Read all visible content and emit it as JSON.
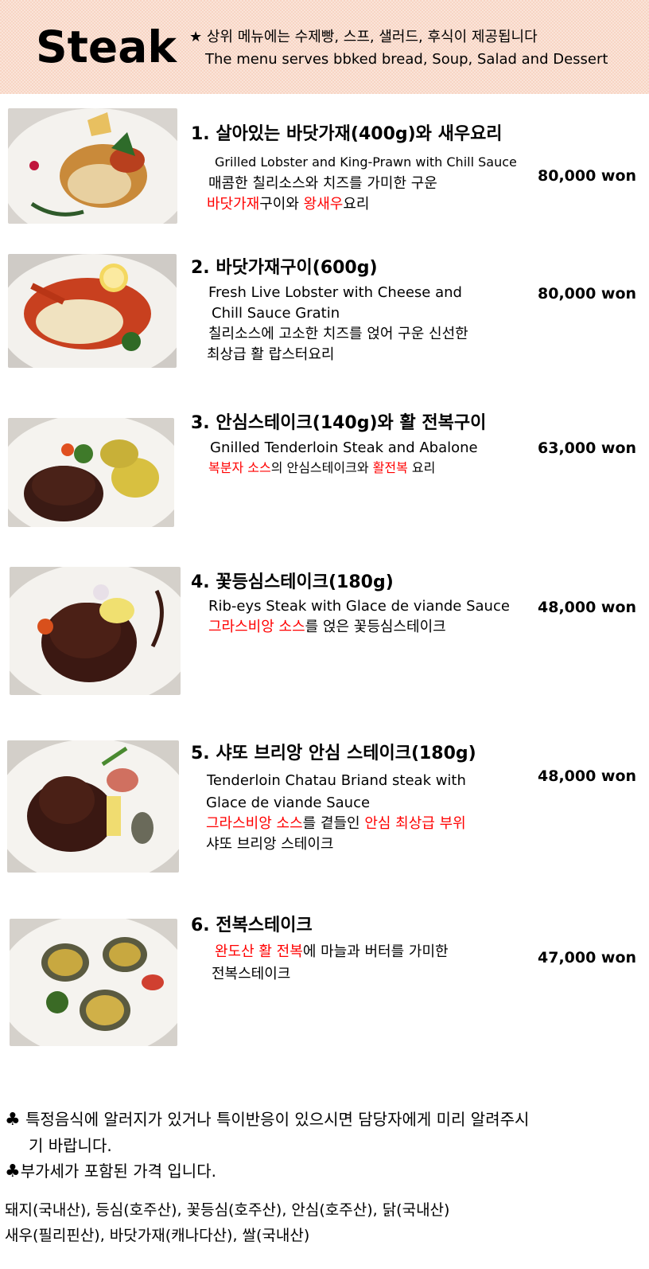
{
  "header": {
    "title": "Steak",
    "note_ko": "★ 상위 메뉴에는 수제빵, 스프, 샐러드, 후식이 제공됩니다",
    "note_en": "The menu serves bbked bread, Soup, Salad and Dessert"
  },
  "items": [
    {
      "name": "1. 살아있는 바닷가재(400g)와 새우요리",
      "en": "Grilled Lobster and King-Prawn with Chill Sauce",
      "ko_1": "매콤한 칠리소스와 치즈를 가미한 구운",
      "ko_2_red_a": "바닷가재",
      "ko_2_mid": "구이와 ",
      "ko_2_red_b": "왕새우",
      "ko_2_end": "요리",
      "price": "80,000 won"
    },
    {
      "name": "2. 바닷가재구이(600g)",
      "en_1": "Fresh Live Lobster with Cheese and",
      "en_2": "Chill Sauce Gratin",
      "ko_1": "칠리소스에 고소한 치즈를 얹어 구운 신선한",
      "ko_2": "최상급 활 랍스터요리",
      "price": "80,000 won"
    },
    {
      "name": "3. 안심스테이크(140g)와 활 전복구이",
      "en": "Gnilled Tenderloin Steak and Abalone",
      "ko_red_a": "복분자 소스",
      "ko_mid": "의 안심스테이크와 ",
      "ko_red_b": "활전복",
      "ko_end": " 요리",
      "price": "63,000 won"
    },
    {
      "name": "4. 꽃등심스테이크(180g)",
      "en": "Rib-eys Steak with Glace de viande Sauce",
      "ko_red": "그라스비앙 소스",
      "ko_end": "를 얹은 꽃등심스테이크",
      "price": "48,000 won"
    },
    {
      "name": "5. 샤또 브리앙 안심 스테이크(180g)",
      "en_1": "Tenderloin Chatau Briand steak with",
      "en_2": "Glace de viande Sauce",
      "ko_red_a": "그라스비앙 소스",
      "ko_mid": "를 곁들인 ",
      "ko_red_b": "안심 최상급 부위",
      "ko_2": "샤또 브리앙 스테이크",
      "price": "48,000 won"
    },
    {
      "name": "6. 전복스테이크",
      "ko_red": "완도산 활 전복",
      "ko_end": "에 마늘과 버터를 가미한",
      "ko_2": "전복스테이크",
      "price": "47,000 won"
    }
  ],
  "notes": {
    "club_icon": "♣",
    "allergy_1": "특정음식에 알러지가 있거나 특이반응이 있으시면 담당자에게 미리 알려주시",
    "allergy_2": "기 바랍니다.",
    "vat": "부가세가 포함된 가격 입니다."
  },
  "origin": {
    "line_1": "돼지(국내산), 등심(호주산), 꽃등심(호주산), 안심(호주산), 닭(국내산)",
    "line_2": "새우(필리핀산), 바닷가재(캐나다산), 쌀(국내산)"
  },
  "colors": {
    "header_bg": "#f8d5c4",
    "highlight": "#ff0000"
  }
}
